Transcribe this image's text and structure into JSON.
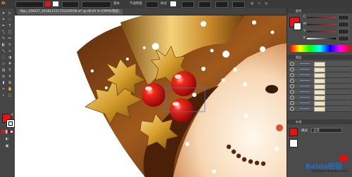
{
  "app": {
    "logo": "Ai",
    "doc_tab": "Ngu_339227_201812151755324558.ai* @ 66.81 % (CMYK/预览)",
    "toolbar_items": [
      "基本",
      "不透明度",
      "样式"
    ],
    "zoom_value": "66.81"
  },
  "colors": {
    "fill": "#e8120e",
    "stroke": "#ffffff",
    "accent": "#c0302a"
  },
  "color_panel": {
    "title": "颜色",
    "channels": [
      {
        "label": "C",
        "value": "0"
      },
      {
        "label": "M",
        "value": "95"
      },
      {
        "label": "Y",
        "value": "90"
      },
      {
        "label": "K",
        "value": "0"
      }
    ]
  },
  "layers_panel": {
    "title": "图层",
    "rows": 9
  },
  "appearance_panel": {
    "title": "外观",
    "mode_label": "模式",
    "mode_value": "正常"
  },
  "watermark": {
    "brand": "Baidu经验",
    "url": "jingyan.baidu.com"
  }
}
